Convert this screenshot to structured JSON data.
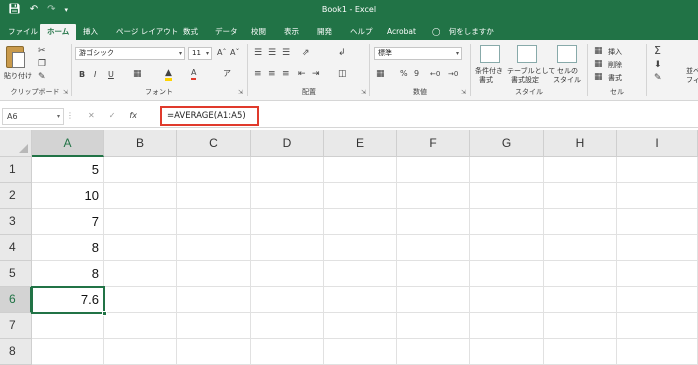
{
  "app": {
    "title": "Book1 - Excel"
  },
  "qat": {
    "save_icon": "save-icon",
    "undo_icon": "undo-icon",
    "redo_icon": "redo-icon",
    "customize_icon": "customize-qat-icon"
  },
  "tabs": [
    {
      "label": "ファイル",
      "active": false
    },
    {
      "label": "ホーム",
      "active": true
    },
    {
      "label": "挿入",
      "active": false
    },
    {
      "label": "ページ レイアウト",
      "active": false
    },
    {
      "label": "数式",
      "active": false
    },
    {
      "label": "データ",
      "active": false
    },
    {
      "label": "校閲",
      "active": false
    },
    {
      "label": "表示",
      "active": false
    },
    {
      "label": "開発",
      "active": false
    },
    {
      "label": "ヘルプ",
      "active": false
    },
    {
      "label": "Acrobat",
      "active": false
    }
  ],
  "tellme": {
    "label": "何をしますか",
    "icon": "lightbulb-icon"
  },
  "ribbon": {
    "clipboard": {
      "paste_label": "貼り付け",
      "group_label": "クリップボード"
    },
    "font": {
      "font_name": "游ゴシック",
      "font_size": "11",
      "bold": "B",
      "italic": "I",
      "underline": "U",
      "group_label": "フォント"
    },
    "alignment": {
      "group_label": "配置"
    },
    "number": {
      "format": "標準",
      "percent": "%",
      "comma": "9",
      "group_label": "数値"
    },
    "styles": {
      "conditional": "条件付き",
      "conditional2": "書式",
      "table": "テーブルとして",
      "table2": "書式設定",
      "cell": "セルの",
      "cell2": "スタイル",
      "group_label": "スタイル"
    },
    "cells": {
      "insert": "挿入",
      "delete": "削除",
      "format": "書式",
      "group_label": "セル"
    },
    "editing": {
      "sum_icon": "autosum-icon",
      "label1": "並べ",
      "label2": "フィル"
    }
  },
  "formula_bar": {
    "name_box": "A6",
    "formula": "=AVERAGE(A1:A5)"
  },
  "grid": {
    "columns": [
      "A",
      "B",
      "C",
      "D",
      "E",
      "F",
      "G",
      "H",
      "I"
    ],
    "rows": [
      "1",
      "2",
      "3",
      "4",
      "5",
      "6",
      "7",
      "8"
    ],
    "selected_column": "A",
    "selected_row": "6",
    "cells_A": [
      "5",
      "10",
      "7",
      "8",
      "8",
      "7.6",
      "",
      ""
    ]
  },
  "colors": {
    "excel_green": "#217346",
    "highlight_red": "#e03a2c"
  }
}
